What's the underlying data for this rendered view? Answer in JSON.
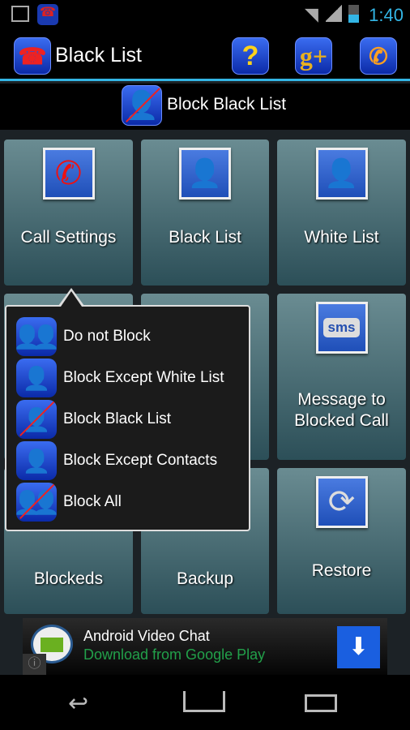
{
  "status": {
    "time": "1:40",
    "icons": [
      "image-icon",
      "app-notification-icon",
      "wifi-icon",
      "signal-icon",
      "battery-icon"
    ]
  },
  "header": {
    "title": "Black List",
    "actions": [
      "help-icon",
      "google-plus-icon",
      "phone-icon"
    ]
  },
  "mode": {
    "label": "Block Black List"
  },
  "tiles": [
    {
      "label": "Call Settings",
      "icon": "phone-icon"
    },
    {
      "label": "Black List",
      "icon": "black-contact-icon"
    },
    {
      "label": "White List",
      "icon": "white-contact-icon"
    },
    {
      "label": "Message to Blocked Call",
      "icon": "sms-icon"
    },
    {
      "label": "Blockeds",
      "icon": ""
    },
    {
      "label": "Backup",
      "icon": ""
    },
    {
      "label": "Restore",
      "icon": "refresh-icon"
    }
  ],
  "sms_text": "sms",
  "popup": {
    "items": [
      {
        "label": "Do not Block",
        "icon": "do-not-block-icon"
      },
      {
        "label": "Block Except White List",
        "icon": "white-contact-icon"
      },
      {
        "label": "Block Black List",
        "icon": "block-black-list-icon"
      },
      {
        "label": "Block Except Contacts",
        "icon": "contacts-icon"
      },
      {
        "label": "Block All",
        "icon": "block-all-icon"
      }
    ]
  },
  "ad": {
    "title": "Android Video Chat",
    "subtitle": "Download from Google Play",
    "colors": {
      "subtitle": "#22a04a",
      "button": "#1a5fe0"
    }
  },
  "colors": {
    "accent": "#33b5e5"
  }
}
